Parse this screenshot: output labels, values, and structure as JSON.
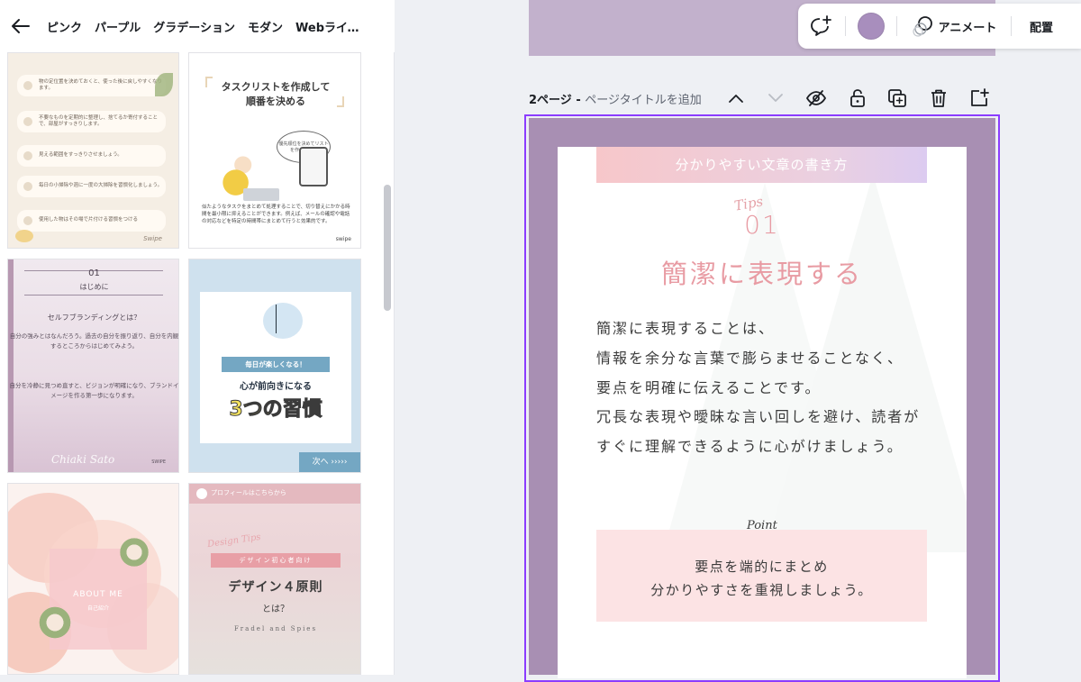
{
  "topnav": {
    "chips": [
      "ピンク",
      "パープル",
      "グラデーション",
      "モダン",
      "Webライタ..."
    ]
  },
  "templates": {
    "t1": {
      "rows": [
        "物の定位置を決めておくと、使った後に戻しやすくなります。",
        "不要なものを定期的に整理し、捨てるか寄付することで、部屋がすっきりします。",
        "見える範囲をすっきりさせましょう。",
        "毎日の小掃除や週に一度の大掃除を習慣化しましょう。",
        "使用した物はその場で片付ける習慣をつける"
      ],
      "swipe": "Swipe"
    },
    "t2": {
      "title_l1": "タスクリストを作成して",
      "title_l2": "順番を決める",
      "bubble": "優先順位を決めてリストを作ろう！！",
      "desc": "似たようなタスクをまとめて処理することで、切り替えにかかる時間を最小限に抑えることができます。例えば、メールの確認や電話の対応などを特定の時間帯にまとめて行うと効果的です。",
      "swipe": "swipe"
    },
    "t3": {
      "num": "01",
      "heading": "はじめに",
      "question": "セルフブランディングとは？",
      "p1": "自分の強みとはなんだろう。過去の自分を振り返り、自分を内観するところからはじめてみよう。",
      "p2": "自分を冷静に見つめ直すと、ビジョンが明確になり、ブランドイメージを作る第一歩になります。",
      "signature": "Chiaki Sato",
      "swipe": "SWIPE"
    },
    "t4": {
      "ribbon": "毎日が楽しくなる！",
      "sub": "心が前向きになる",
      "big": "3つの習慣",
      "next": "次へ ›››››"
    },
    "t5": {
      "title": "ABOUT ME",
      "subtitle": "自己紹介"
    },
    "t6": {
      "top": "プロフィールはこちらから",
      "tips": "Design Tips",
      "label": "デザイン初心者向け",
      "main": "デザイン４原則",
      "toha": "とは？",
      "author": "Fradel and Spies"
    }
  },
  "toolbar": {
    "animate_label": "アニメート",
    "arrange_label": "配置",
    "color": "#a88ebd"
  },
  "page_header": {
    "page_label": "2ページ",
    "separator": " - ",
    "add_title": "ページタイトルを追加"
  },
  "slide": {
    "banner": "分かりやすい文章の書き方",
    "tips_script": "Tips",
    "number": "01",
    "headline": "簡潔に表現する",
    "body_lines": [
      "簡潔に表現することは、",
      "情報を余分な言葉で膨らませることなく、",
      "要点を明確に伝えることです。",
      "冗長な表現や曖昧な言い回しを避け、読者が",
      "すぐに理解できるように心がけましょう。"
    ],
    "point_script": "Point",
    "point_l1": "要点を端的にまとめ",
    "point_l2": "分かりやすさを重視しましょう。",
    "frame_color": "#a88fb3",
    "accent_color": "#e89ba3"
  }
}
